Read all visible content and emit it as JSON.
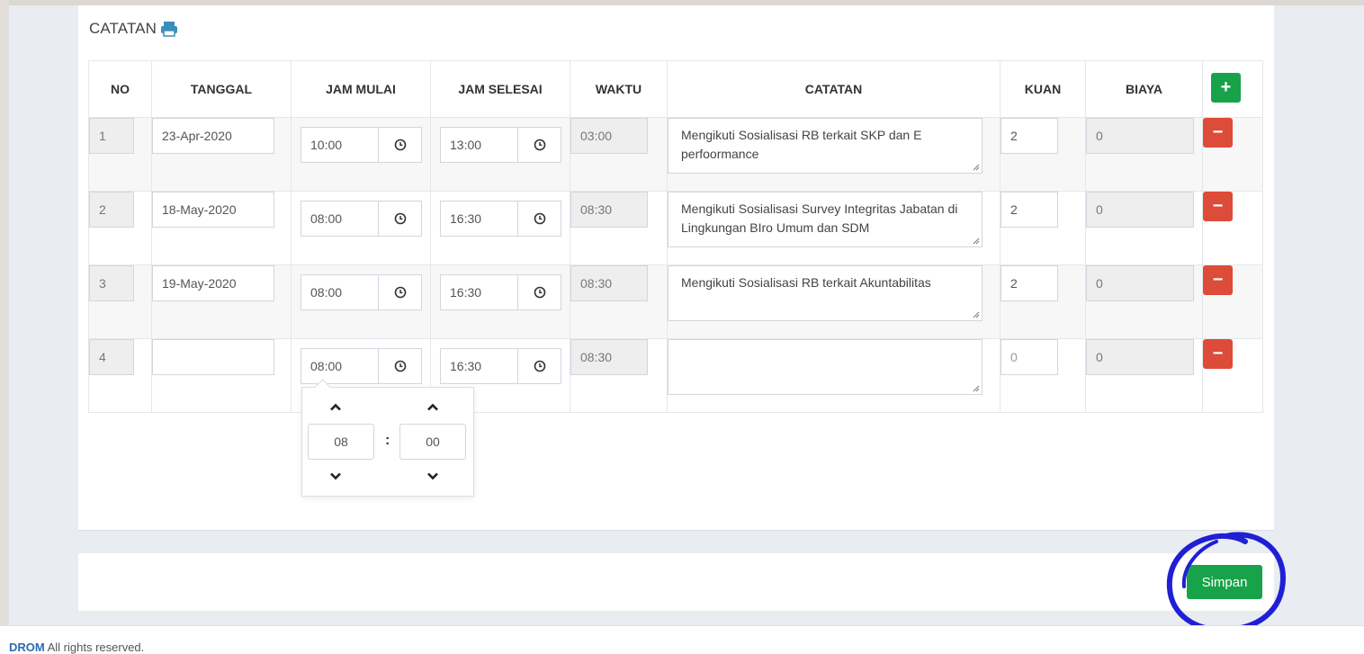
{
  "section": {
    "title": "CATATAN"
  },
  "table": {
    "headers": [
      "NO",
      "TANGGAL",
      "JAM MULAI",
      "JAM SELESAI",
      "WAKTU",
      "CATATAN",
      "KUAN",
      "BIAYA"
    ],
    "rows": [
      {
        "no": "1",
        "tanggal": "23-Apr-2020",
        "jam_mulai": "10:00",
        "jam_selesai": "13:00",
        "waktu": "03:00",
        "catatan": "Mengikuti Sosialisasi RB terkait SKP dan E perfoormance",
        "kuan": "2",
        "biaya": "0"
      },
      {
        "no": "2",
        "tanggal": "18-May-2020",
        "jam_mulai": "08:00",
        "jam_selesai": "16:30",
        "waktu": "08:30",
        "catatan": "Mengikuti Sosialisasi Survey Integritas Jabatan di Lingkungan BIro Umum dan SDM",
        "kuan": "2",
        "biaya": "0"
      },
      {
        "no": "3",
        "tanggal": "19-May-2020",
        "jam_mulai": "08:00",
        "jam_selesai": "16:30",
        "waktu": "08:30",
        "catatan": "Mengikuti Sosialisasi RB terkait Akuntabilitas",
        "kuan": "2",
        "biaya": "0"
      },
      {
        "no": "4",
        "tanggal": "",
        "jam_mulai": "08:00",
        "jam_selesai": "16:30",
        "waktu": "08:30",
        "catatan": "",
        "kuan": "0",
        "biaya": "0"
      }
    ]
  },
  "timepicker": {
    "hour": "08",
    "minute": "00",
    "separator": ":"
  },
  "actions": {
    "add_label": "+",
    "remove_label": "−",
    "save_label": "Simpan"
  },
  "footer": {
    "brand": "DROM",
    "rights": "All rights reserved."
  },
  "colors": {
    "success": "#18a34a",
    "danger": "#dd4b39",
    "annotation": "#1f1fd6",
    "icon": "#3c8dbc"
  }
}
